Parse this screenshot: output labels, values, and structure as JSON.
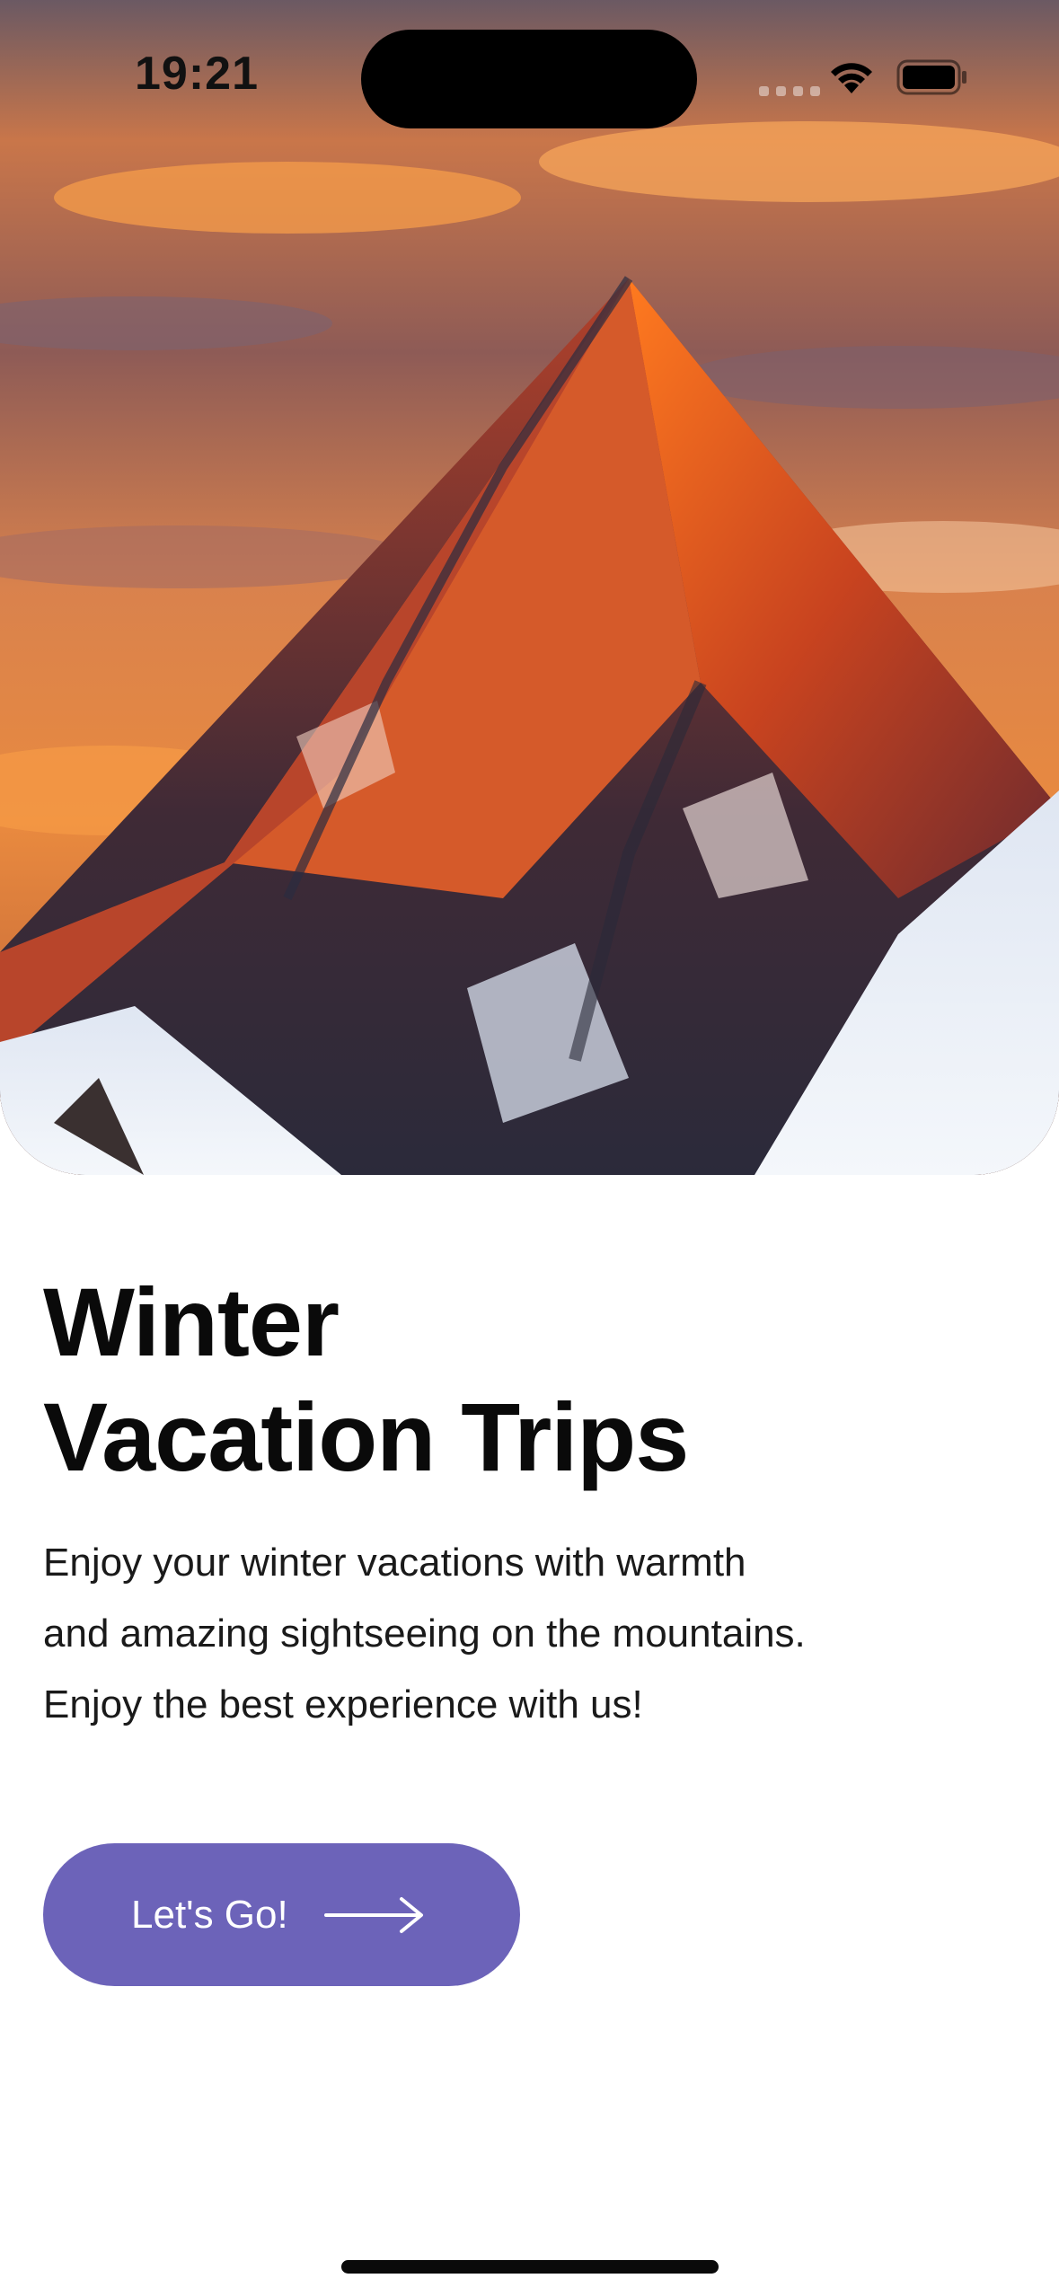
{
  "status_bar": {
    "time": "19:21",
    "icons": [
      "cellular-dots-icon",
      "wifi-icon",
      "battery-icon"
    ]
  },
  "hero": {
    "image": "snowy-mountain-peak-at-sunset"
  },
  "content": {
    "title_line1": "Winter",
    "title_line2": "Vacation Trips",
    "description_line1": "Enjoy your winter vacations with warmth",
    "description_line2": "and amazing sightseeing on the mountains.",
    "description_line3": "Enjoy the best experience with us!"
  },
  "cta": {
    "label": "Let's Go!",
    "icon": "arrow-right-icon",
    "color": "#6c63b9"
  }
}
